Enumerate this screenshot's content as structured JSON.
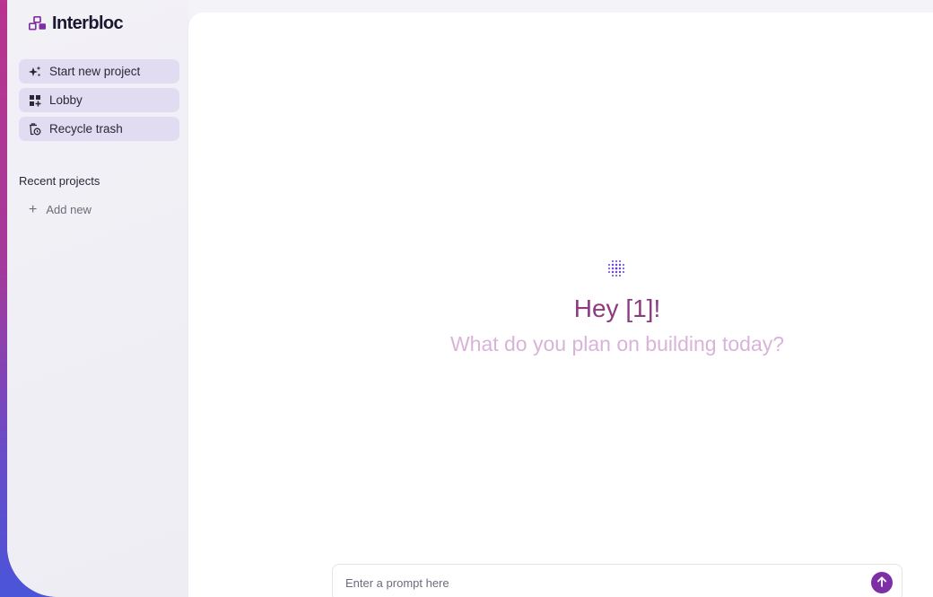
{
  "brand": {
    "name": "Interbloc"
  },
  "sidebar": {
    "nav": [
      {
        "label": "Start new project",
        "icon": "sparkles-icon"
      },
      {
        "label": "Lobby",
        "icon": "grid-icon"
      },
      {
        "label": "Recycle trash",
        "icon": "trash-restore-icon"
      }
    ],
    "recent_title": "Recent projects",
    "add_new": "Add new"
  },
  "main": {
    "greeting": "Hey [1]!",
    "subgreeting": "What do you plan on building today?",
    "prompt_placeholder": "Enter a prompt here",
    "send_icon": "arrow-up-icon"
  },
  "colors": {
    "accent": "#7e2fa5",
    "greeting": "#8e3a80",
    "subgreeting": "#d9b3d8",
    "nav_bg": "#e1dcf1"
  }
}
